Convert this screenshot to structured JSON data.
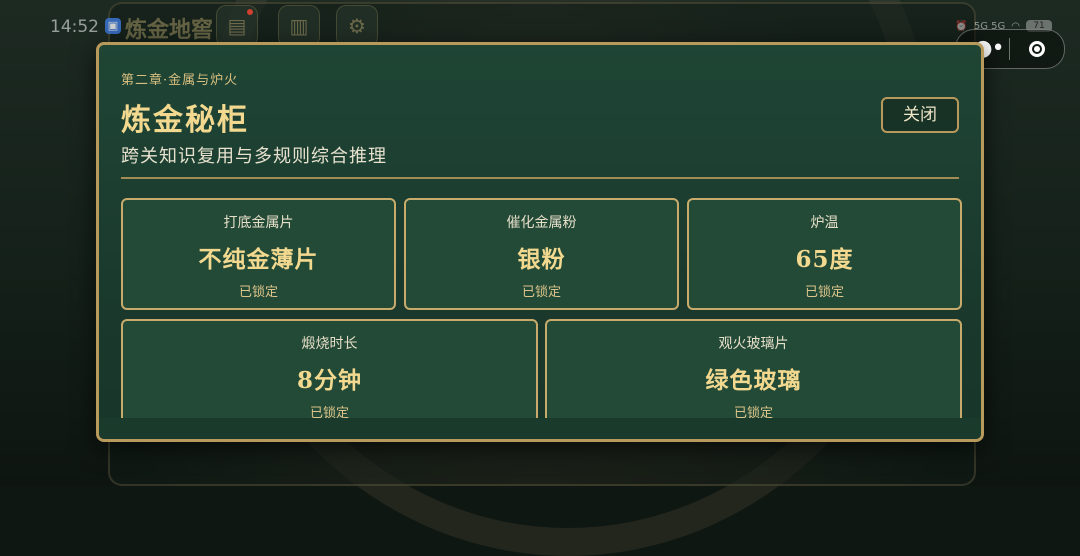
{
  "status_bar": {
    "time": "14:52",
    "network": "5G 5G",
    "battery": "71"
  },
  "background": {
    "title": "炼金地窖"
  },
  "modal": {
    "chapter": "第二章·金属与炉火",
    "title": "炼金秘柜",
    "subtitle": "跨关知识复用与多规则综合推理",
    "close_label": "关闭",
    "cards": [
      {
        "label": "打底金属片",
        "value": "不纯金薄片",
        "status": "已锁定"
      },
      {
        "label": "催化金属粉",
        "value": "银粉",
        "status": "已锁定"
      },
      {
        "label": "炉温",
        "value": "65度",
        "status": "已锁定"
      },
      {
        "label": "煅烧时长",
        "value": "8分钟",
        "status": "已锁定"
      },
      {
        "label": "观火玻璃片",
        "value": "绿色玻璃",
        "status": "已锁定"
      }
    ]
  },
  "icons": {
    "book": "book-icon",
    "map": "map-icon",
    "settings": "gear-icon",
    "more": "more-icon",
    "miniprogram_close": "close-icon"
  },
  "colors": {
    "accent_gold": "#f2d98f",
    "border_gold": "#b89a5c",
    "modal_green": "#1f4535"
  }
}
